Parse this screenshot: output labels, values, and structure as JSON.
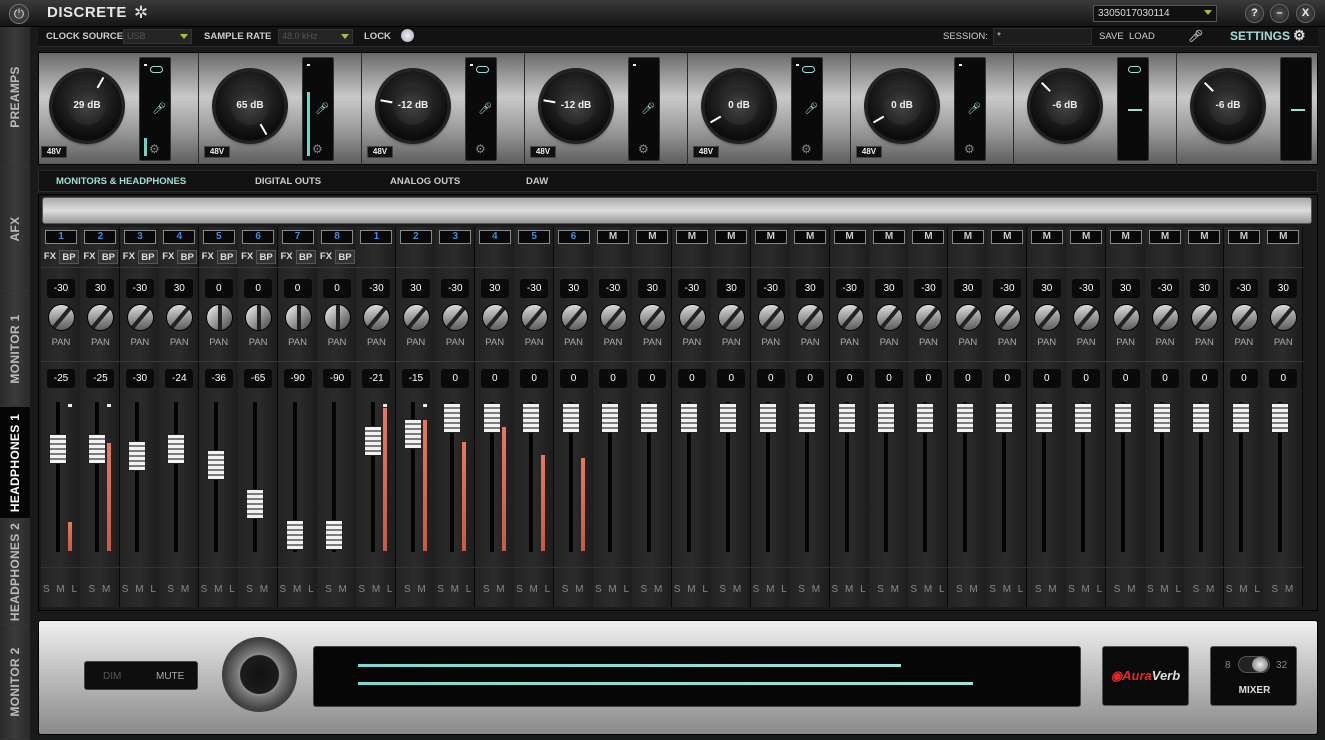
{
  "window": {
    "app_name": "DISCRETE",
    "device_select": "3305017030114",
    "help_label": "?",
    "minimize_label": "–",
    "close_label": "X"
  },
  "side_tabs": [
    "PREAMPS",
    "AFX",
    "MONITOR 1",
    "HEADPHONES 1",
    "HEADPHONES 2",
    "MONITOR 2"
  ],
  "settings_bar": {
    "clock_source_label": "CLOCK SOURCE",
    "clock_source_value": "USB",
    "sample_rate_label": "SAMPLE RATE",
    "sample_rate_value": "48.0 kHz",
    "lock_label": "LOCK",
    "session_label": "SESSION:",
    "session_value": "*",
    "save_label": "SAVE",
    "load_label": "LOAD",
    "settings_label": "SETTINGS"
  },
  "preamps": [
    {
      "gain": "29 dB",
      "phantom": "48V",
      "input_icon": "mic",
      "link": true,
      "level": 0.2
    },
    {
      "gain": "65 dB",
      "phantom": "48V",
      "input_icon": "mic",
      "link": false,
      "level": 0.7
    },
    {
      "gain": "-12 dB",
      "phantom": "48V",
      "input_icon": "mic",
      "link": true,
      "level": 0
    },
    {
      "gain": "-12 dB",
      "phantom": "48V",
      "input_icon": "mic",
      "link": false,
      "level": 0
    },
    {
      "gain": "0 dB",
      "phantom": "48V",
      "input_icon": "mic",
      "link": true,
      "level": 0
    },
    {
      "gain": "0 dB",
      "phantom": "48V",
      "input_icon": "mic",
      "link": false,
      "level": 0
    },
    {
      "gain": "-6 dB",
      "phantom": "",
      "input_icon": "line",
      "link": true,
      "level": 0
    },
    {
      "gain": "-6 dB",
      "phantom": "",
      "input_icon": "line",
      "link": false,
      "level": 0
    }
  ],
  "mix_tabs": [
    "MONITORS & HEADPHONES",
    "DIGITAL OUTS",
    "ANALOG OUTS",
    "DAW"
  ],
  "colors": {
    "accent": "#9fe0d6",
    "meter": "#e8775f",
    "channel_blue": "#3f8ae6"
  },
  "channel_labels": {
    "fx": "FX",
    "bp": "BP",
    "pan": "PAN"
  },
  "channels": [
    {
      "num": "1",
      "group": "a",
      "fxbp": true,
      "pan": "-30",
      "vol": "-25",
      "sml": "S M L",
      "fader": 0.69,
      "meter": 0.2,
      "peak": true
    },
    {
      "num": "2",
      "group": "a",
      "fxbp": true,
      "pan": "30",
      "vol": "-25",
      "sml": "S M",
      "fader": 0.69,
      "meter": 0.74,
      "peak": true
    },
    {
      "num": "3",
      "group": "a",
      "fxbp": true,
      "pan": "-30",
      "vol": "-30",
      "sml": "S M L",
      "fader": 0.64,
      "meter": 0,
      "peak": false
    },
    {
      "num": "4",
      "group": "a",
      "fxbp": true,
      "pan": "30",
      "vol": "-24",
      "sml": "S M",
      "fader": 0.69,
      "meter": 0,
      "peak": false
    },
    {
      "num": "5",
      "group": "a",
      "fxbp": true,
      "pan": "0",
      "vol": "-36",
      "sml": "S M L",
      "fader": 0.58,
      "meter": 0,
      "peak": false
    },
    {
      "num": "6",
      "group": "a",
      "fxbp": true,
      "pan": "0",
      "vol": "-65",
      "sml": "S M",
      "fader": 0.32,
      "meter": 0,
      "peak": false
    },
    {
      "num": "7",
      "group": "a",
      "fxbp": true,
      "pan": "0",
      "vol": "-90",
      "sml": "S M L",
      "fader": 0.11,
      "meter": 0,
      "peak": false
    },
    {
      "num": "8",
      "group": "a",
      "fxbp": true,
      "pan": "0",
      "vol": "-90",
      "sml": "S M",
      "fader": 0.11,
      "meter": 0,
      "peak": false
    },
    {
      "num": "1",
      "group": "b",
      "fxbp": false,
      "pan": "-30",
      "vol": "-21",
      "sml": "S M L",
      "fader": 0.74,
      "meter": 0.98,
      "peak": true
    },
    {
      "num": "2",
      "group": "b",
      "fxbp": false,
      "pan": "30",
      "vol": "-15",
      "sml": "S M",
      "fader": 0.79,
      "meter": 0.9,
      "peak": true
    },
    {
      "num": "3",
      "group": "b",
      "fxbp": false,
      "pan": "-30",
      "vol": "0",
      "sml": "S M L",
      "fader": 0.9,
      "meter": 0.75,
      "peak": false
    },
    {
      "num": "4",
      "group": "b",
      "fxbp": false,
      "pan": "30",
      "vol": "0",
      "sml": "S M",
      "fader": 0.9,
      "meter": 0.85,
      "peak": false
    },
    {
      "num": "5",
      "group": "b",
      "fxbp": false,
      "pan": "-30",
      "vol": "0",
      "sml": "S M L",
      "fader": 0.9,
      "meter": 0.66,
      "peak": false
    },
    {
      "num": "6",
      "group": "b",
      "fxbp": false,
      "pan": "30",
      "vol": "0",
      "sml": "S M",
      "fader": 0.9,
      "meter": 0.64,
      "peak": false
    },
    {
      "num": "M",
      "group": "c",
      "fxbp": false,
      "pan": "-30",
      "vol": "0",
      "sml": "S M L",
      "fader": 0.9,
      "meter": 0,
      "peak": false
    },
    {
      "num": "M",
      "group": "c",
      "fxbp": false,
      "pan": "30",
      "vol": "0",
      "sml": "S M",
      "fader": 0.9,
      "meter": 0,
      "peak": false
    },
    {
      "num": "M",
      "group": "c",
      "fxbp": false,
      "pan": "-30",
      "vol": "0",
      "sml": "S M L",
      "fader": 0.9,
      "meter": 0,
      "peak": false
    },
    {
      "num": "M",
      "group": "c",
      "fxbp": false,
      "pan": "30",
      "vol": "0",
      "sml": "S M",
      "fader": 0.9,
      "meter": 0,
      "peak": false
    },
    {
      "num": "M",
      "group": "c",
      "fxbp": false,
      "pan": "-30",
      "vol": "0",
      "sml": "S M L",
      "fader": 0.9,
      "meter": 0,
      "peak": false
    },
    {
      "num": "M",
      "group": "c",
      "fxbp": false,
      "pan": "30",
      "vol": "0",
      "sml": "S M",
      "fader": 0.9,
      "meter": 0,
      "peak": false
    },
    {
      "num": "M",
      "group": "c",
      "fxbp": false,
      "pan": "-30",
      "vol": "0",
      "sml": "S M L",
      "fader": 0.9,
      "meter": 0,
      "peak": false
    },
    {
      "num": "M",
      "group": "c",
      "fxbp": false,
      "pan": "30",
      "vol": "0",
      "sml": "S M",
      "fader": 0.9,
      "meter": 0,
      "peak": false
    },
    {
      "num": "M",
      "group": "c",
      "fxbp": false,
      "pan": "-30",
      "vol": "0",
      "sml": "S M L",
      "fader": 0.9,
      "meter": 0,
      "peak": false
    },
    {
      "num": "M",
      "group": "c",
      "fxbp": false,
      "pan": "30",
      "vol": "0",
      "sml": "S M",
      "fader": 0.9,
      "meter": 0,
      "peak": false
    },
    {
      "num": "M",
      "group": "c",
      "fxbp": false,
      "pan": "-30",
      "vol": "0",
      "sml": "S M L",
      "fader": 0.9,
      "meter": 0,
      "peak": false
    },
    {
      "num": "M",
      "group": "c",
      "fxbp": false,
      "pan": "30",
      "vol": "0",
      "sml": "S M",
      "fader": 0.9,
      "meter": 0,
      "peak": false
    },
    {
      "num": "M",
      "group": "c",
      "fxbp": false,
      "pan": "-30",
      "vol": "0",
      "sml": "S M L",
      "fader": 0.9,
      "meter": 0,
      "peak": false
    },
    {
      "num": "M",
      "group": "c",
      "fxbp": false,
      "pan": "30",
      "vol": "0",
      "sml": "S M",
      "fader": 0.9,
      "meter": 0,
      "peak": false
    },
    {
      "num": "M",
      "group": "c",
      "fxbp": false,
      "pan": "-30",
      "vol": "0",
      "sml": "S M L",
      "fader": 0.9,
      "meter": 0,
      "peak": false
    },
    {
      "num": "M",
      "group": "c",
      "fxbp": false,
      "pan": "30",
      "vol": "0",
      "sml": "S M",
      "fader": 0.9,
      "meter": 0,
      "peak": false
    },
    {
      "num": "M",
      "group": "c",
      "fxbp": false,
      "pan": "-30",
      "vol": "0",
      "sml": "S M L",
      "fader": 0.9,
      "meter": 0,
      "peak": false
    },
    {
      "num": "M",
      "group": "c",
      "fxbp": false,
      "pan": "30",
      "vol": "0",
      "sml": "S M",
      "fader": 0.9,
      "meter": 0,
      "peak": false
    }
  ],
  "bottom": {
    "dim_label": "DIM",
    "mute_label": "MUTE",
    "output_meter_levels": [
      0.75,
      0.85
    ],
    "auraverb_part1": "Aura",
    "auraverb_part2": "Verb",
    "mixer_min": "8",
    "mixer_max": "32",
    "mixer_label": "MIXER"
  }
}
